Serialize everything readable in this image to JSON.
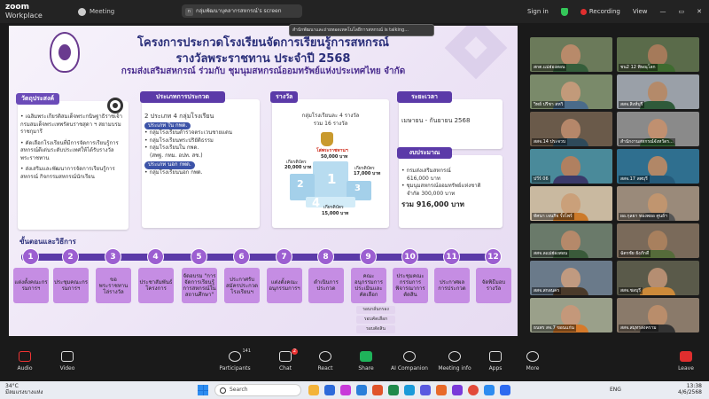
{
  "titlebar": {
    "app_line1": "zoom",
    "app_line2": "Workplace",
    "meeting_label": "Meeting",
    "share_title": "กลุ่มพัฒนาบุคลากรสหกรณ์'s screen",
    "share_badge": "n",
    "sign_in": "Sign in",
    "recording": "Recording",
    "view": "View"
  },
  "talking": "สำนักพัฒนาและถ่ายทอดเทคโนโลยีการสหกรณ์ is talking...",
  "slide": {
    "title1": "โครงการประกวดโรงเรียนจัดการเรียนรู้การสหกรณ์",
    "title2": "รางวัลพระราชทาน ประจำปี 2568",
    "title3": "กรมส่งเสริมสหกรณ์ ร่วมกับ ชุมนุมสหกรณ์ออมทรัพย์แห่งประเทศไทย จำกัด",
    "objectives": {
      "header": "วัตถุประสงค์",
      "items": [
        "• เฉลิมพระเกียรติสมเด็จพระกนิษฐาธิราชเจ้า กรมสมเด็จพระเทพรัตนราชสุดา ฯ สยามบรมราชกุมารี",
        "• คัดเลือกโรงเรียนที่มีการจัดการเรียนรู้การสหกรณ์ดีเด่นระดับประเทศให้ได้รับรางวัลพระราชทาน",
        "• ส่งเสริมและพัฒนาการจัดการเรียนรู้การสหกรณ์ กิจกรรมสหกรณ์นักเรียน"
      ]
    },
    "types": {
      "header": "ประเภทการประกวด",
      "summary": "2 ประเภท 4 กลุ่มโรงเรียน",
      "in_tag": "ประเภท ใน กพด.",
      "in_items": [
        "• กลุ่มโรงเรียนตำรวจตระเวนชายแดน",
        "• กลุ่มโรงเรียนพระปริยัติธรรม",
        "• กลุ่มโรงเรียนใน กพด.",
        "(สพฐ. กทม. อปท. สช.)"
      ],
      "out_tag": "ประเภท นอก กพด.",
      "out_items": [
        "• กลุ่มโรงเรียนนอก กพด."
      ]
    },
    "award": {
      "header": "รางวัล",
      "line1": "กลุ่มโรงเรียนละ 4 รางวัล",
      "line2": "รวม 16 รางวัล",
      "royal": "โล่พระราชทานฯ",
      "royal_amount": "50,000 บาท",
      "second_label": "เกียรติบัตร",
      "second_amount": "20,000 บาท",
      "third_label": "เกียรติบัตร",
      "third_amount": "17,000 บาท",
      "fourth_label": "เกียรติบัตร",
      "fourth_amount": "15,000 บาท",
      "p1": "1",
      "p2": "2",
      "p3": "3",
      "p4": "4"
    },
    "period": {
      "header": "ระยะเวลา",
      "text": "เมษายน - กันยายน 2568"
    },
    "budget": {
      "header": "งบประมาณ",
      "items": [
        "• กรมส่งเสริมสหกรณ์",
        "616,000 บาท",
        "• ชุมนุมสหกรณ์ออมทรัพย์แห่งชาติ",
        "จำกัด 300,000 บาท"
      ],
      "total": "รวม 916,000 บาท"
    },
    "steps_header": "ขั้นตอนและวิธีการ",
    "steps": [
      {
        "n": "1",
        "t": "แต่งตั้งคณะกรรมการฯ"
      },
      {
        "n": "2",
        "t": "ประชุมคณะกรรมการฯ"
      },
      {
        "n": "3",
        "t": "ขอพระราชทานโล่รางวัล"
      },
      {
        "n": "4",
        "t": "ประชาสัมพันธ์โครงการ"
      },
      {
        "n": "5",
        "t": "จัดอบรม \"การจัดการเรียนรู้การสหกรณ์ในสถานศึกษา\""
      },
      {
        "n": "6",
        "t": "ประกาศรับสมัครประกวดโรงเรียนฯ"
      },
      {
        "n": "7",
        "t": "แต่งตั้งคณะอนุกรรมการฯ"
      },
      {
        "n": "8",
        "t": "ดำเนินการประกวด"
      },
      {
        "n": "9",
        "t": "คณะอนุกรรมการประเมินและคัดเลือก"
      },
      {
        "n": "10",
        "t": "ประชุมคณะกรรมการพิจารณาการตัดสิน"
      },
      {
        "n": "11",
        "t": "ประกาศผลการประกวด"
      },
      {
        "n": "12",
        "t": "จัดพิธีมอบรางวัล"
      }
    ],
    "sub_steps": [
      "รอบกลั่นกรอง",
      "รอบคัดเลือก",
      "รอบตัดสิน"
    ]
  },
  "gallery": [
    {
      "name": "สกต.แม่ฮ่องสอน",
      "bg": "#6b7a5a",
      "face": "#b88a6a",
      "body": "#355e3b"
    },
    {
      "name": "ชน2 12 พิษณุโลก",
      "bg": "#5a6b4a",
      "face": "#a57a5a",
      "body": "#3e6b2f"
    },
    {
      "name": "วิทย์ ปรีชา สหวิ",
      "bg": "#7a8a6a",
      "face": "#c29a7a",
      "body": "#4a6b8a"
    },
    {
      "name": "สสจ.สิงห์บุรี",
      "bg": "#9aa0a8",
      "face": "#b48a6a",
      "body": "#2f5a3a"
    },
    {
      "name": "สสจ.14 ประจวบ",
      "bg": "#6a5a4a",
      "face": "#b5876a",
      "body": "#2e4a5a"
    },
    {
      "name": "สำนักงานสหกรณ์จังหวัดร...",
      "bg": "#8a8a8a",
      "face": "#c09070",
      "body": "#3a6a3a"
    },
    {
      "name": "ปวีร์ 06",
      "bg": "#4a8a9a",
      "face": "#b08060",
      "body": "#3a3a6a"
    },
    {
      "name": "สสจ.17 ลพบุรี",
      "bg": "#2f6f8f",
      "face": "#b18767",
      "body": "#245a7a"
    },
    {
      "name": "ทัศนา เจนกิจ รั้งโพร์",
      "bg": "#c9b9a0",
      "face": "#caa07a",
      "body": "#cc7a2a"
    },
    {
      "name": "ผอ.กุลยา ทองพยอ ศูนย์ฯ",
      "bg": "#9a8a7a",
      "face": "#c0956f",
      "body": "#555"
    },
    {
      "name": "สสจ.ลแม่ฮ่องสอน",
      "bg": "#6a7a6a",
      "face": "#b5896a",
      "body": "#3a5a3a"
    },
    {
      "name": "ฉัตรชัย ยังภักดี",
      "bg": "#7a6a5a",
      "face": "#a8805e",
      "body": "#556b3a"
    },
    {
      "name": "สสจ.สกลนคร",
      "bg": "#6a7a8a",
      "face": "#c09a80",
      "body": "#4a3a2a"
    },
    {
      "name": "สสจ.ชลบุรี",
      "bg": "#5a5a4a",
      "face": "#b58e72",
      "body": "#cc8a3a"
    },
    {
      "name": "ธนพร สจ.7 ขอนแก่น",
      "bg": "#9aa08a",
      "face": "#c4987a",
      "body": "#d67a2a"
    },
    {
      "name": "สสจ.สมุทรสงคราม",
      "bg": "#8a7a6a",
      "face": "#b98d6b",
      "body": "#333"
    }
  ],
  "toolbar": {
    "audio": "Audio",
    "video": "Video",
    "participants": "Participants",
    "participants_count": "141",
    "chat": "Chat",
    "chat_badge": "2",
    "react": "React",
    "share": "Share",
    "ai": "AI Companion",
    "info": "Meeting info",
    "apps": "Apps",
    "more": "More",
    "leave": "Leave"
  },
  "taskbar": {
    "temp": "34°C",
    "weather": "มีลมแรงบางแห่ง",
    "search": "Search",
    "lang": "ENG",
    "time": "13:38",
    "date": "4/6/2568"
  }
}
